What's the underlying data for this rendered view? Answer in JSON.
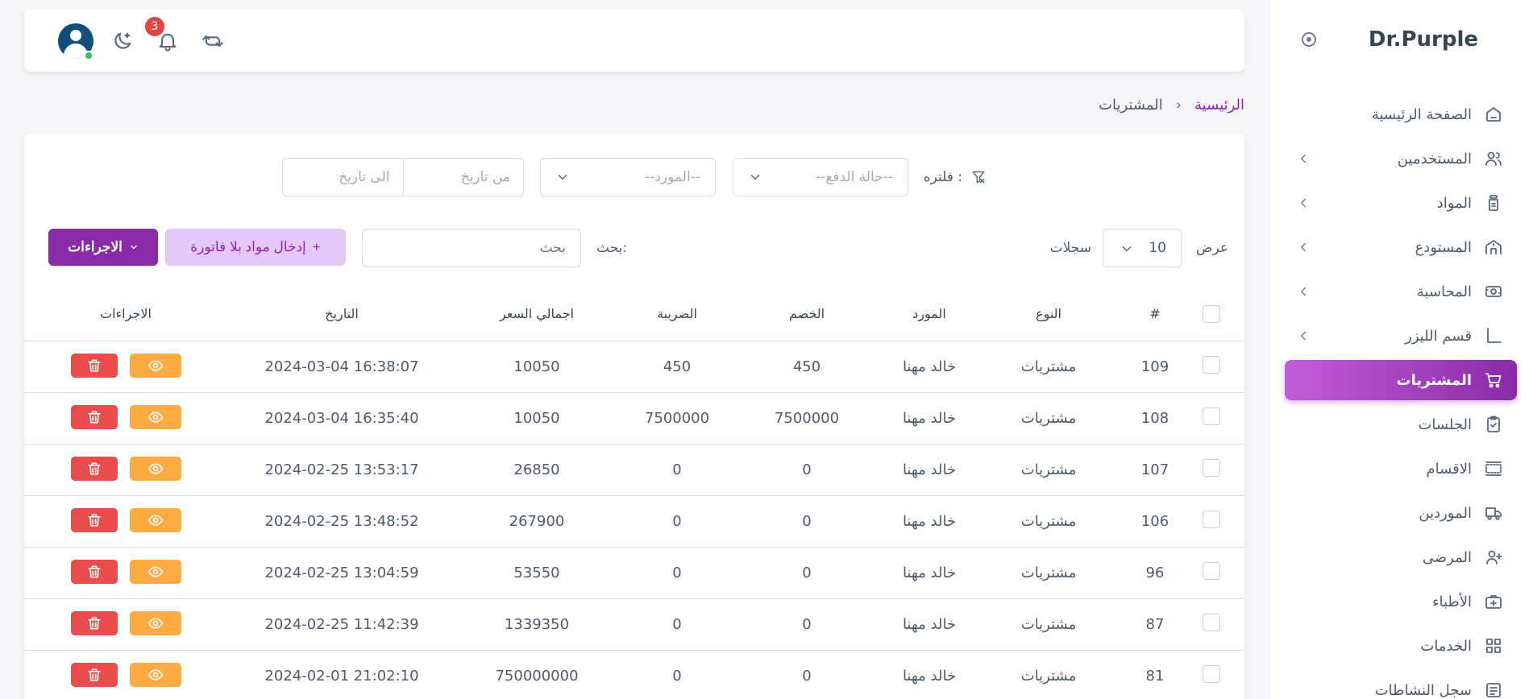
{
  "brand": {
    "name": "Dr.Purple",
    "toggle_icon": "radio-circle-icon"
  },
  "sidebar": {
    "items": [
      {
        "label": "الصفحة الرئيسية",
        "icon": "home-icon",
        "has_children": false,
        "active": false
      },
      {
        "label": "المستخدمين",
        "icon": "users-icon",
        "has_children": true,
        "active": false
      },
      {
        "label": "المواد",
        "icon": "bottle-icon",
        "has_children": true,
        "active": false
      },
      {
        "label": "المستودع",
        "icon": "building-icon",
        "has_children": true,
        "active": false
      },
      {
        "label": "المحاسبة",
        "icon": "cash-icon",
        "has_children": true,
        "active": false
      },
      {
        "label": "قسم الليزر",
        "icon": "angle-icon",
        "has_children": true,
        "active": false
      },
      {
        "label": "المشتريات",
        "icon": "cart-icon",
        "has_children": false,
        "active": true
      },
      {
        "label": "الجلسات",
        "icon": "clipboard-icon",
        "has_children": false,
        "active": false
      },
      {
        "label": "الاقسام",
        "icon": "sections-icon",
        "has_children": false,
        "active": false
      },
      {
        "label": "الموردين",
        "icon": "truck-icon",
        "has_children": false,
        "active": false
      },
      {
        "label": "المرضى",
        "icon": "user-plus-icon",
        "has_children": false,
        "active": false
      },
      {
        "label": "الأطباء",
        "icon": "medical-bag-icon",
        "has_children": false,
        "active": false
      },
      {
        "label": "الخدمات",
        "icon": "grid-icon",
        "has_children": false,
        "active": false
      },
      {
        "label": "سجل النشاطات",
        "icon": "list-icon",
        "has_children": false,
        "active": false
      }
    ]
  },
  "navbar": {
    "notification_count": "3",
    "icons": [
      "user-avatar-icon",
      "moon-icon",
      "bell-icon",
      "sync-icon"
    ]
  },
  "breadcrumb": {
    "home": "الرئيسية",
    "separator": "›",
    "current": "المشتريات"
  },
  "filters": {
    "label": "فلتره :",
    "payment_status_placeholder": "--حالة الدفع--",
    "supplier_placeholder": "--المورد--",
    "from_date_placeholder": "من تاريخ",
    "to_date_placeholder": "الى تاريخ"
  },
  "controls": {
    "show_label": "عرض",
    "page_length": "10",
    "records_label": "سجلات",
    "search_label": "بحث:",
    "search_placeholder": "بحث",
    "add_button": "إدخال مواد بلا فاتورة",
    "add_button_prefix": "+",
    "actions_button": "الاجراءات"
  },
  "table": {
    "headers": {
      "id": "#",
      "type": "النوع",
      "supplier": "المورد",
      "discount": "الخصم",
      "tax": "الضريبة",
      "total": "اجمالي السعر",
      "date": "التاريخ",
      "actions": "الاجراءات"
    },
    "rows": [
      {
        "id": "109",
        "type": "مشتريات",
        "supplier": "خالد مهنا",
        "discount": "450",
        "tax": "450",
        "total": "10050",
        "date": "2024-03-04 16:38:07"
      },
      {
        "id": "108",
        "type": "مشتريات",
        "supplier": "خالد مهنا",
        "discount": "7500000",
        "tax": "7500000",
        "total": "10050",
        "date": "2024-03-04 16:35:40"
      },
      {
        "id": "107",
        "type": "مشتريات",
        "supplier": "خالد مهنا",
        "discount": "0",
        "tax": "0",
        "total": "26850",
        "date": "2024-02-25 13:53:17"
      },
      {
        "id": "106",
        "type": "مشتريات",
        "supplier": "خالد مهنا",
        "discount": "0",
        "tax": "0",
        "total": "267900",
        "date": "2024-02-25 13:48:52"
      },
      {
        "id": "96",
        "type": "مشتريات",
        "supplier": "خالد مهنا",
        "discount": "0",
        "tax": "0",
        "total": "53550",
        "date": "2024-02-25 13:04:59"
      },
      {
        "id": "87",
        "type": "مشتريات",
        "supplier": "خالد مهنا",
        "discount": "0",
        "tax": "0",
        "total": "1339350",
        "date": "2024-02-25 11:42:39"
      },
      {
        "id": "81",
        "type": "مشتريات",
        "supplier": "خالد مهنا",
        "discount": "0",
        "tax": "0",
        "total": "750000000",
        "date": "2024-02-01 21:02:10"
      }
    ]
  },
  "colors": {
    "brand_purple": "#8a2aa8",
    "light_purple": "#e4c8f8",
    "view_orange": "#ffab42",
    "delete_red": "#ea4b4b",
    "badge_red": "#e04545",
    "online_green": "#2dc46b"
  }
}
